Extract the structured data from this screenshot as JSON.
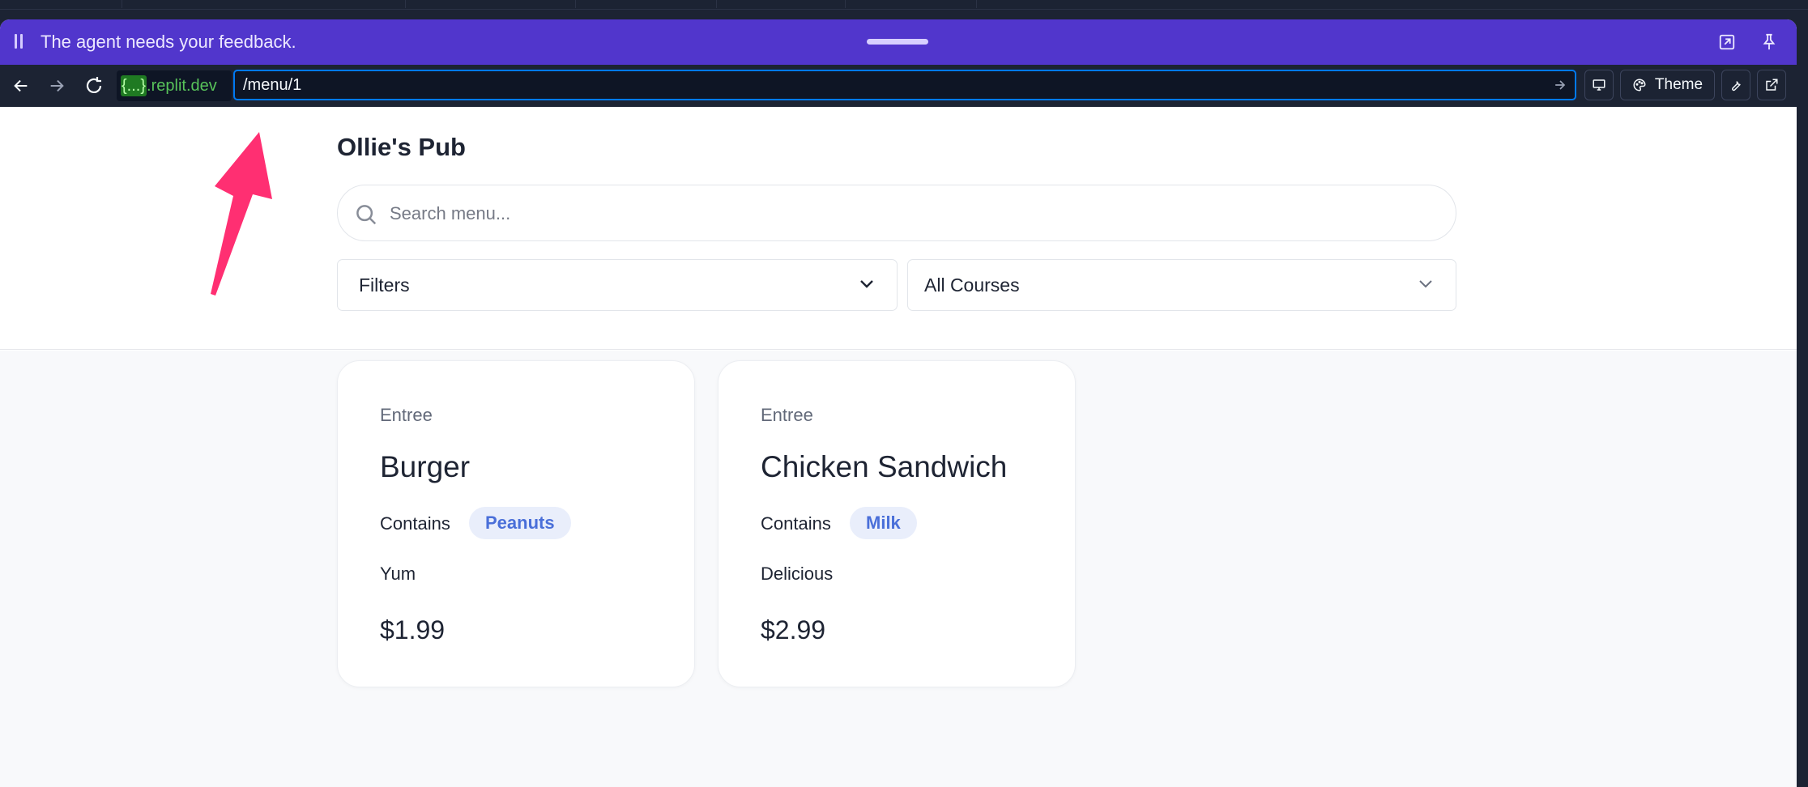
{
  "feedback_bar": {
    "message": "The agent needs your feedback."
  },
  "browser": {
    "domain_highlight": "{...}",
    "domain_suffix": ".replit.dev",
    "url_path": "/menu/1",
    "theme_label": "Theme"
  },
  "app": {
    "title": "Ollie's Pub",
    "search_placeholder": "Search menu...",
    "filters_label": "Filters",
    "courses_label": "All Courses"
  },
  "menu_items": [
    {
      "course": "Entree",
      "name": "Burger",
      "contains_label": "Contains",
      "allergen": "Peanuts",
      "description": "Yum",
      "price": "$1.99"
    },
    {
      "course": "Entree",
      "name": "Chicken Sandwich",
      "contains_label": "Contains",
      "allergen": "Milk",
      "description": "Delicious",
      "price": "$2.99"
    }
  ],
  "colors": {
    "feedback_bar": "#5136cc",
    "browser_bar": "#1c2333",
    "url_border": "#0079f2",
    "domain_green": "#58c35a",
    "allergen_text": "#4a6fd9",
    "allergen_bg": "#e9eefb",
    "annotation_arrow": "#ff2f72"
  },
  "icons": [
    "drag-grip-icon",
    "expand-icon",
    "pin-icon",
    "back-arrow-icon",
    "forward-arrow-icon",
    "reload-icon",
    "go-arrow-icon",
    "device-icon",
    "palette-icon",
    "wrench-icon",
    "external-link-icon",
    "search-icon",
    "chevron-down-icon"
  ]
}
